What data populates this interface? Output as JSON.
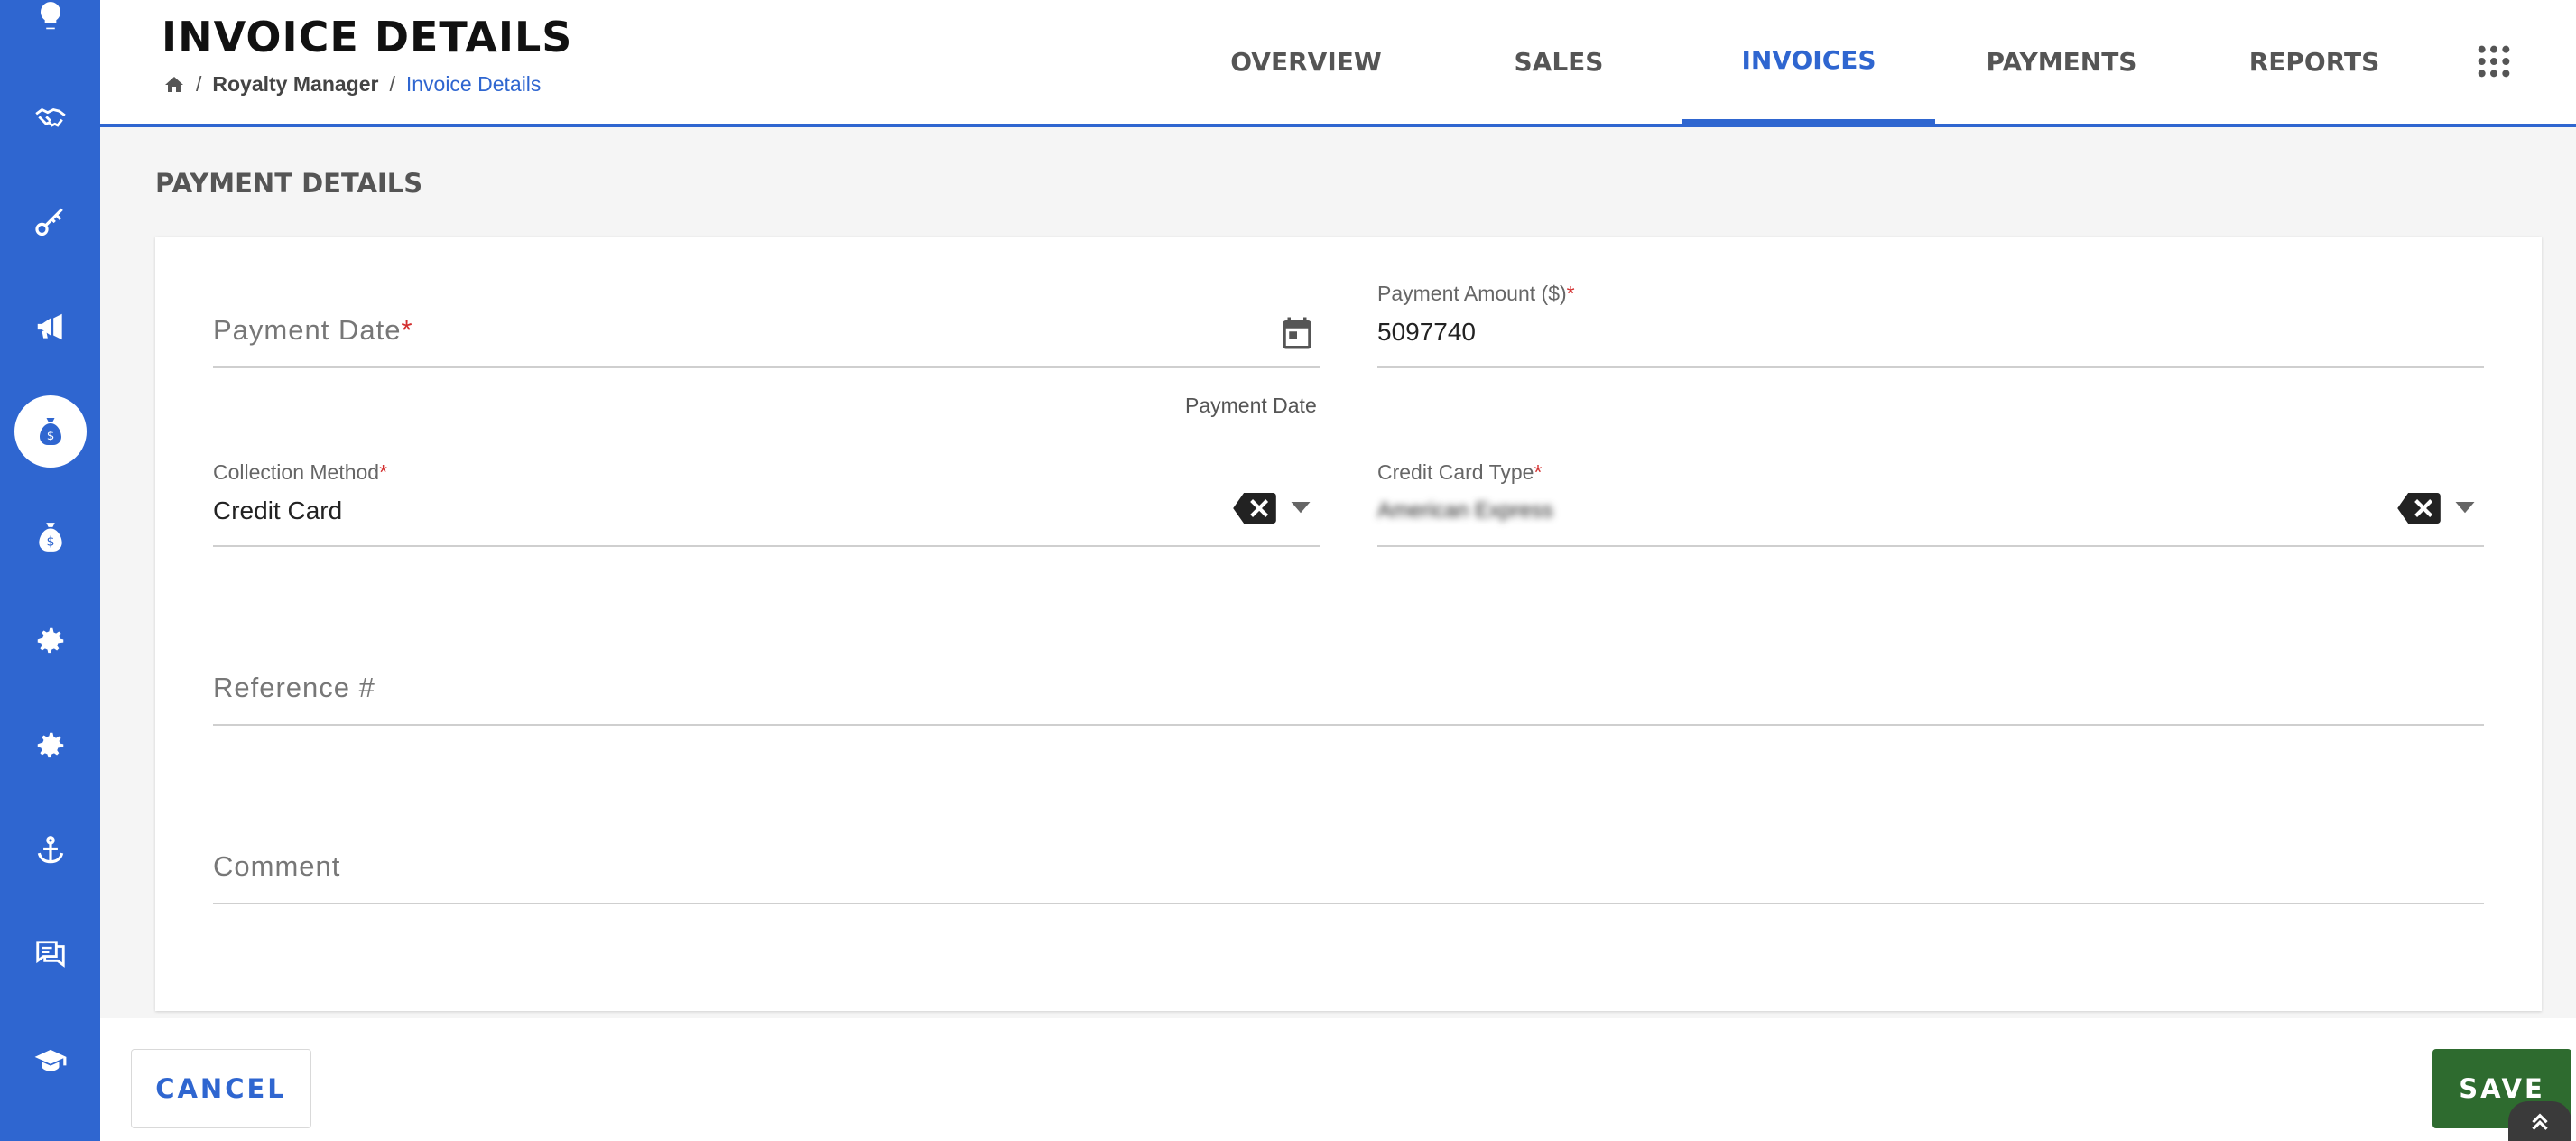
{
  "header": {
    "title": "INVOICE DETAILS",
    "breadcrumb": {
      "home_icon": "home-icon",
      "separator": "/",
      "items": [
        "Royalty Manager",
        "Invoice Details"
      ]
    },
    "tabs": [
      {
        "label": "OVERVIEW",
        "active": false
      },
      {
        "label": "SALES",
        "active": false
      },
      {
        "label": "INVOICES",
        "active": true
      },
      {
        "label": "PAYMENTS",
        "active": false
      },
      {
        "label": "REPORTS",
        "active": false
      }
    ],
    "apps_icon": "apps-grid-icon"
  },
  "sidebar": {
    "items": [
      {
        "icon": "lightbulb-icon",
        "active": false
      },
      {
        "icon": "handshake-icon",
        "active": false
      },
      {
        "icon": "key-icon",
        "active": false
      },
      {
        "icon": "megaphone-icon",
        "active": false
      },
      {
        "icon": "money-bag-icon",
        "active": true
      },
      {
        "icon": "money-bag-icon",
        "active": false
      },
      {
        "icon": "gear-icon",
        "active": false
      },
      {
        "icon": "gear-icon",
        "active": false
      },
      {
        "icon": "anchor-icon",
        "active": false
      },
      {
        "icon": "chat-icon",
        "active": false
      },
      {
        "icon": "graduation-cap-icon",
        "active": false
      }
    ]
  },
  "section": {
    "title": "PAYMENT DETAILS"
  },
  "form": {
    "payment_date": {
      "label": "Payment Date",
      "required_mark": "*",
      "value": "",
      "helper": "Payment Date",
      "icon": "calendar-icon"
    },
    "payment_amount": {
      "label": "Payment Amount ($)",
      "required_mark": "*",
      "value": "5097740"
    },
    "collection_method": {
      "label": "Collection Method",
      "required_mark": "*",
      "value": "Credit Card"
    },
    "credit_card_type": {
      "label": "Credit Card Type",
      "required_mark": "*",
      "value": "American Express"
    },
    "reference": {
      "label": "Reference #",
      "value": ""
    },
    "comment": {
      "label": "Comment",
      "value": ""
    }
  },
  "footer": {
    "cancel_label": "CANCEL",
    "save_label": "SAVE",
    "scroll_top_icon": "chevrons-up-icon"
  },
  "colors": {
    "primary": "#2f66d0",
    "save": "#2e6b2f",
    "required": "#d32f2f"
  }
}
